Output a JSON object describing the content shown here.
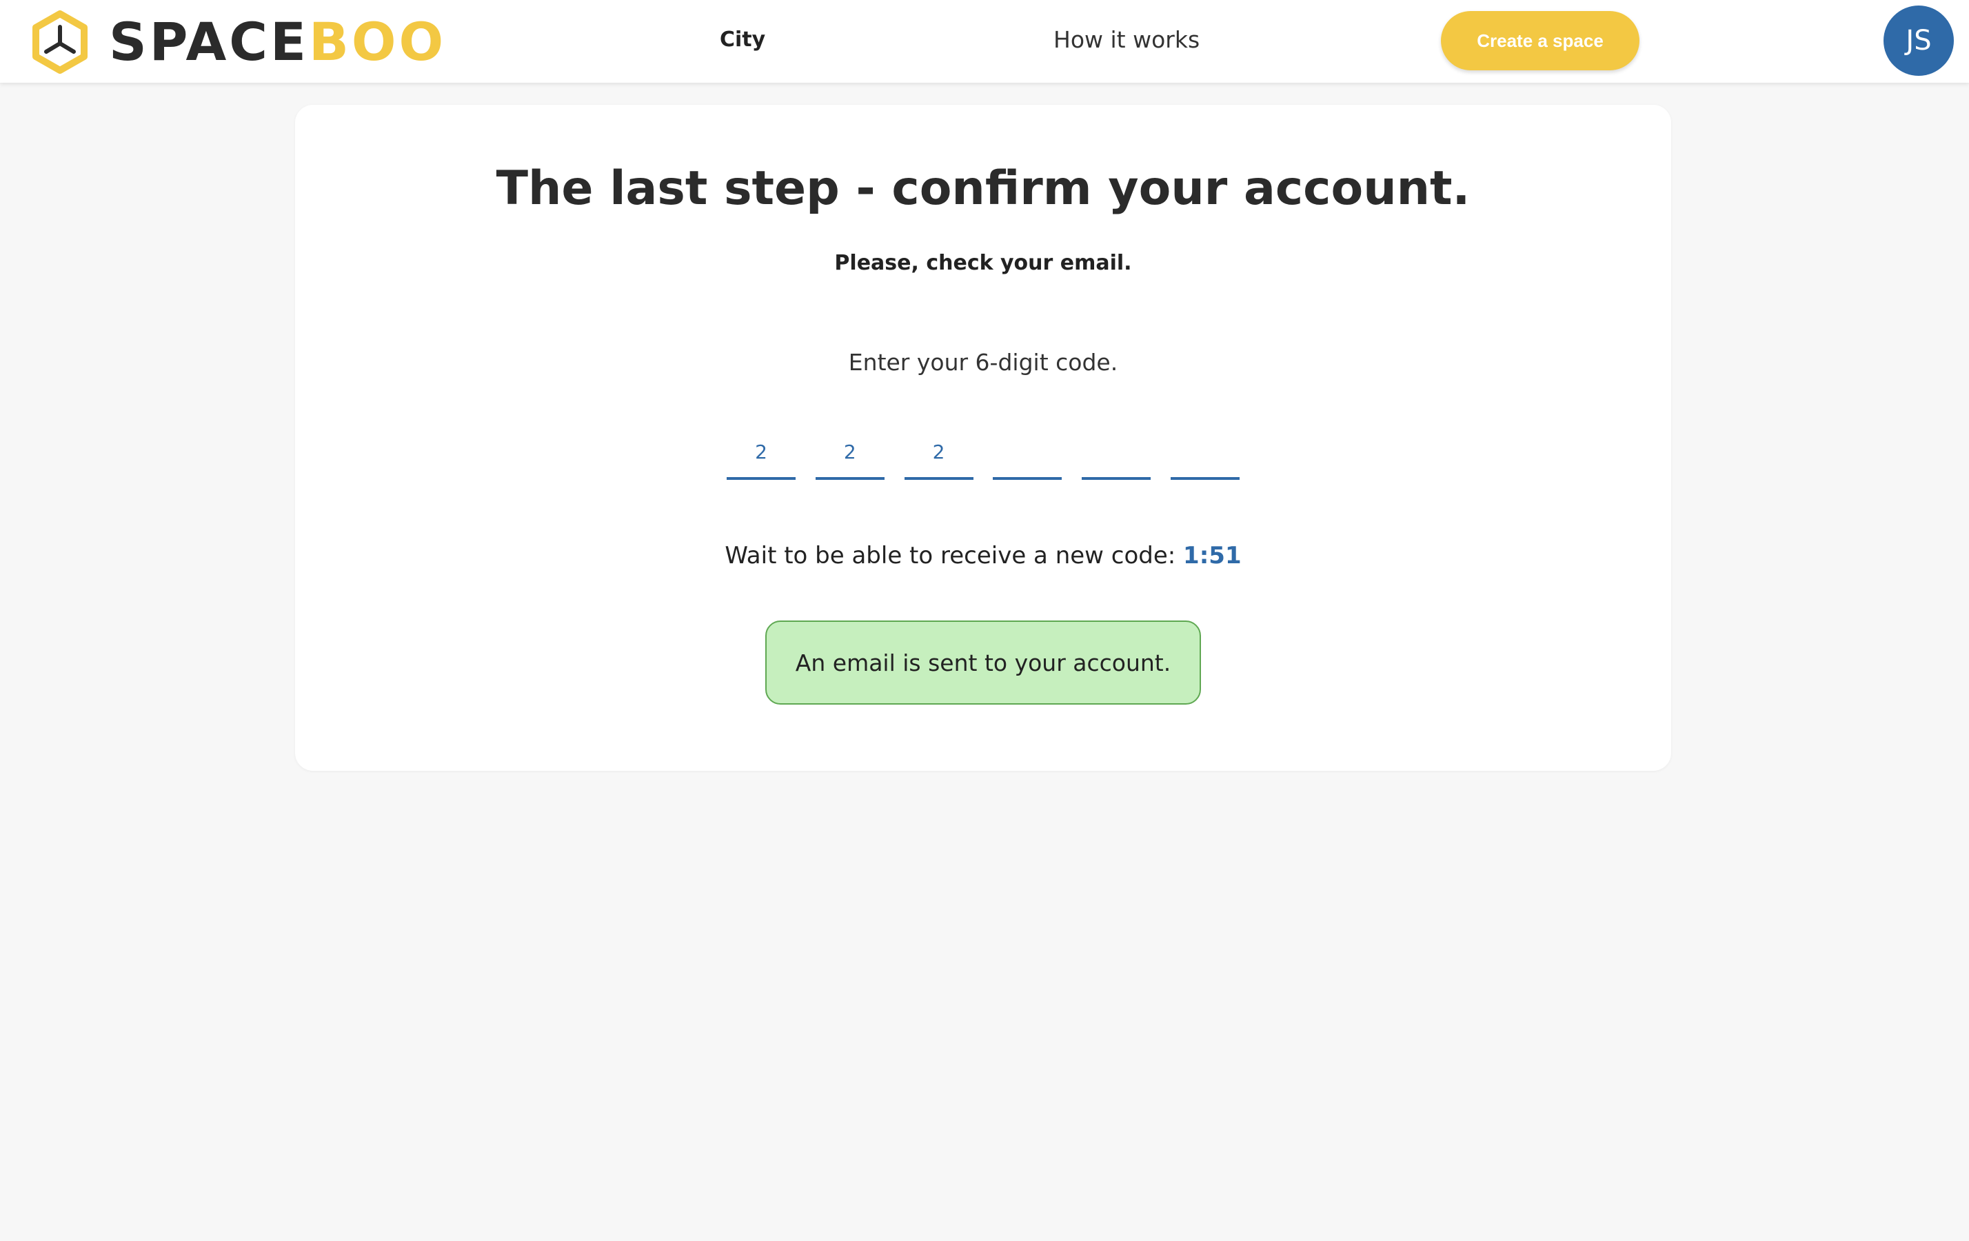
{
  "header": {
    "logo": {
      "word_dark": "SPACE",
      "word_gold": "BOO"
    },
    "nav": {
      "city": "City",
      "how_it_works": "How it works"
    },
    "create_button": "Create a space",
    "avatar_initials": "JS"
  },
  "main": {
    "title": "The last step - confirm your account.",
    "subtitle": "Please, check your email.",
    "instruction": "Enter your 6-digit code.",
    "code_digits": [
      "2",
      "2",
      "2",
      "",
      "",
      ""
    ],
    "timer": {
      "label": "Wait to be able to receive a new code:",
      "value": "1:51"
    },
    "alert": "An email is sent to your account."
  },
  "colors": {
    "brand_gold": "#f3c843",
    "brand_dark": "#2b2b2b",
    "accent_blue": "#2f6aa8",
    "success_bg": "#c6efbe",
    "success_border": "#5fa852",
    "page_bg": "#f7f7f7"
  },
  "icons": {
    "logo_mark": "hexagon-tripod-logo-icon"
  }
}
